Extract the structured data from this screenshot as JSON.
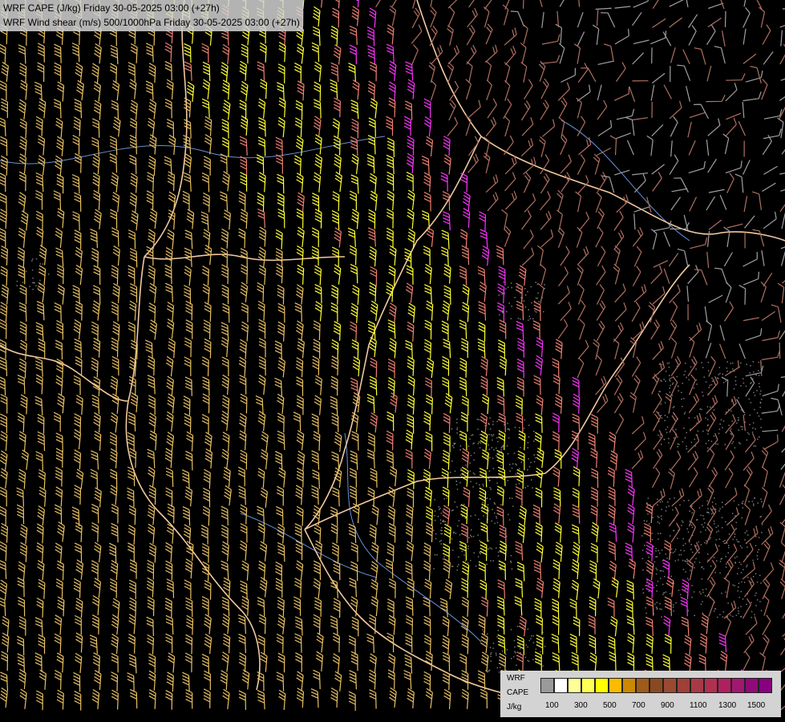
{
  "title": {
    "line1": "WRF CAPE (J/kg) Friday 30-05-2025 03:00 (+27h)",
    "line2": "WRF Wind shear (m/s) 500/1000hPa Friday 30-05-2025 03:00 (+27h)"
  },
  "legend": {
    "label_model": "WRF",
    "label_field": "CAPE",
    "label_unit": "J/kg",
    "ticks": [
      "100",
      "300",
      "500",
      "700",
      "900",
      "1100",
      "1300",
      "1500"
    ],
    "colors": [
      "#9a9a9a",
      "#ffffff",
      "#ffff9a",
      "#ffff55",
      "#ffff00",
      "#ffbb00",
      "#cc8800",
      "#a05a1a",
      "#8a4a20",
      "#9a4a30",
      "#a04038",
      "#a83a48",
      "#b03050",
      "#b02060",
      "#a01870",
      "#900a78",
      "#880080"
    ]
  },
  "colors": {
    "barb_yellow": "#ffff33",
    "barb_orange": "#e8c060",
    "barb_salmon": "#f08070",
    "barb_magenta": "#ff33ff",
    "barb_brown": "#b07060",
    "barb_gray": "#a0a0a0",
    "border": "#f0c8a0",
    "river": "#6a8fd8"
  }
}
